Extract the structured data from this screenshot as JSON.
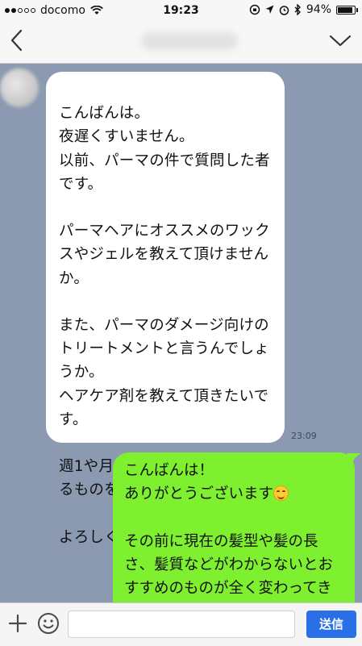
{
  "status_bar": {
    "carrier": "docomo",
    "time": "19:23",
    "battery": "94%",
    "battery_level": 0.94
  },
  "nav": {
    "back_icon": "chevron-left-icon",
    "menu_icon": "chevron-down-icon"
  },
  "messages": [
    {
      "side": "received",
      "text": "こんばんは。\n夜遅くすいません。\n以前、パーマの件で質問した者です。\n\nパーマヘアにオススメのワックスやジェルを教えて頂けませんか。\n\nまた、パーマのダメージ向けのトリートメントと言うんでしょうか。\nヘアケア剤を教えて頂きたいです。\n\n週1や月1ぐらいの頻度で使えるものを希望しております。\n\nよろしくお願い致します。",
      "time": "23:09"
    },
    {
      "side": "sent",
      "line1": "こんばんは！",
      "line2": "ありがとうございます",
      "rest": "\nその前に現在の髪型や髪の長さ、髪質などがわからないとおすすめのものが全く変わってきてしまいます。"
    }
  ],
  "input_bar": {
    "plus_icon": "plus-icon",
    "sticker_icon": "smile-icon",
    "send_label": "送信"
  },
  "colors": {
    "chat_bg": "#8b9ab1",
    "received_bubble": "#ffffff",
    "sent_bubble": "#7ef02f",
    "send_button": "#2a6fe6"
  }
}
